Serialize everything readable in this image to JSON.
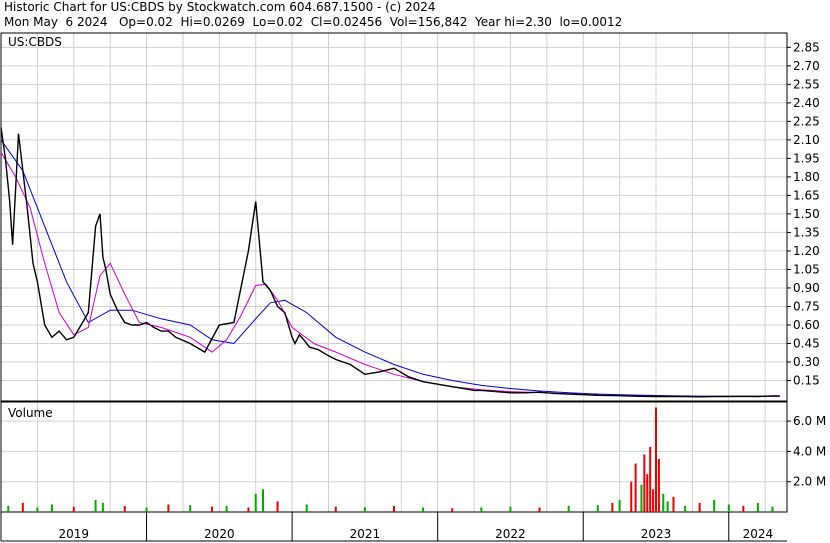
{
  "header": {
    "line1": "Historic Chart for US:CBDS by Stockwatch.com 604.687.1500 - (c) 2024",
    "line2": "Mon May  6 2024   Op=0.02  Hi=0.0269  Lo=0.02  Cl=0.02456  Vol=156,842  Year hi=2.30  lo=0.0012"
  },
  "chart_data": [
    {
      "type": "line",
      "title": "US:CBDS",
      "yticks": [
        "0.15",
        "0.30",
        "0.45",
        "0.60",
        "0.75",
        "0.90",
        "1.05",
        "1.20",
        "1.35",
        "1.50",
        "1.65",
        "1.80",
        "1.95",
        "2.10",
        "2.25",
        "2.40",
        "2.55",
        "2.70",
        "2.85"
      ],
      "ylim": [
        0,
        2.95
      ],
      "xlim": [
        2019.0,
        2024.4
      ],
      "grid": true,
      "colors": {
        "price": "#000000",
        "ma_short": "#cc00cc",
        "ma_long": "#0000cc"
      },
      "series": [
        {
          "id": "price",
          "x": [
            2019.0,
            2019.03,
            2019.06,
            2019.08,
            2019.1,
            2019.12,
            2019.16,
            2019.18,
            2019.22,
            2019.25,
            2019.3,
            2019.35,
            2019.4,
            2019.45,
            2019.5,
            2019.55,
            2019.6,
            2019.65,
            2019.68,
            2019.7,
            2019.72,
            2019.75,
            2019.8,
            2019.85,
            2019.9,
            2019.95,
            2020.0,
            2020.05,
            2020.1,
            2020.15,
            2020.2,
            2020.3,
            2020.4,
            2020.5,
            2020.6,
            2020.7,
            2020.75,
            2020.8,
            2020.85,
            2020.9,
            2020.95,
            2021.0,
            2021.02,
            2021.05,
            2021.08,
            2021.12,
            2021.18,
            2021.25,
            2021.3,
            2021.4,
            2021.5,
            2021.6,
            2021.7,
            2021.8,
            2021.9,
            2022.0,
            2022.1,
            2022.2,
            2022.25,
            2022.3,
            2022.4,
            2022.5,
            2022.6,
            2022.7,
            2022.8,
            2022.9,
            2023.0,
            2023.1,
            2023.2,
            2023.3,
            2023.4,
            2023.5,
            2023.6,
            2023.7,
            2023.8,
            2023.9,
            2024.0,
            2024.1,
            2024.2,
            2024.3,
            2024.35
          ],
          "y": [
            2.2,
            1.95,
            1.6,
            1.25,
            1.7,
            2.15,
            1.75,
            1.55,
            1.1,
            0.95,
            0.6,
            0.5,
            0.55,
            0.48,
            0.5,
            0.6,
            0.7,
            1.4,
            1.5,
            1.15,
            1.05,
            0.85,
            0.72,
            0.62,
            0.6,
            0.6,
            0.62,
            0.58,
            0.55,
            0.55,
            0.5,
            0.45,
            0.38,
            0.6,
            0.62,
            1.2,
            1.6,
            0.95,
            0.88,
            0.75,
            0.7,
            0.5,
            0.45,
            0.52,
            0.48,
            0.42,
            0.4,
            0.35,
            0.32,
            0.28,
            0.2,
            0.22,
            0.25,
            0.18,
            0.14,
            0.12,
            0.1,
            0.08,
            0.07,
            0.07,
            0.06,
            0.05,
            0.05,
            0.055,
            0.045,
            0.04,
            0.035,
            0.03,
            0.028,
            0.025,
            0.022,
            0.02,
            0.02,
            0.02,
            0.018,
            0.02,
            0.02,
            0.022,
            0.02,
            0.025,
            0.025
          ]
        },
        {
          "id": "ma_short",
          "x": [
            2019.0,
            2019.1,
            2019.2,
            2019.3,
            2019.4,
            2019.5,
            2019.6,
            2019.68,
            2019.75,
            2019.85,
            2019.95,
            2020.1,
            2020.3,
            2020.45,
            2020.55,
            2020.65,
            2020.75,
            2020.82,
            2020.9,
            2021.0,
            2021.15,
            2021.3,
            2021.5,
            2021.7,
            2021.9,
            2022.1,
            2022.3,
            2022.5,
            2022.7,
            2022.9,
            2023.1,
            2023.3,
            2023.5,
            2023.7,
            2023.9,
            2024.1,
            2024.35
          ],
          "y": [
            2.0,
            1.8,
            1.55,
            1.1,
            0.7,
            0.52,
            0.58,
            1.0,
            1.1,
            0.85,
            0.62,
            0.58,
            0.5,
            0.38,
            0.48,
            0.68,
            0.92,
            0.93,
            0.8,
            0.58,
            0.45,
            0.38,
            0.28,
            0.2,
            0.14,
            0.1,
            0.075,
            0.06,
            0.052,
            0.042,
            0.032,
            0.026,
            0.022,
            0.02,
            0.02,
            0.021,
            0.023
          ]
        },
        {
          "id": "ma_long",
          "x": [
            2019.0,
            2019.15,
            2019.3,
            2019.45,
            2019.6,
            2019.75,
            2019.9,
            2020.1,
            2020.3,
            2020.45,
            2020.6,
            2020.75,
            2020.85,
            2020.95,
            2021.1,
            2021.3,
            2021.5,
            2021.7,
            2021.9,
            2022.1,
            2022.3,
            2022.5,
            2022.7,
            2022.9,
            2023.1,
            2023.3,
            2023.5,
            2023.7,
            2023.9,
            2024.1,
            2024.35
          ],
          "y": [
            2.1,
            1.85,
            1.4,
            0.95,
            0.62,
            0.72,
            0.72,
            0.65,
            0.6,
            0.48,
            0.45,
            0.65,
            0.78,
            0.8,
            0.7,
            0.5,
            0.38,
            0.28,
            0.2,
            0.15,
            0.11,
            0.085,
            0.065,
            0.05,
            0.04,
            0.033,
            0.028,
            0.024,
            0.022,
            0.021,
            0.022
          ]
        }
      ]
    },
    {
      "type": "bar",
      "title": "Volume",
      "yticks": [
        "2.0 M",
        "4.0 M",
        "6.0 M"
      ],
      "ylim": [
        0,
        7000000
      ],
      "colors": {
        "up": "#00aa00",
        "down": "#ee0000"
      },
      "x": [
        2019.05,
        2019.15,
        2019.25,
        2019.35,
        2019.5,
        2019.65,
        2019.7,
        2019.85,
        2020.0,
        2020.15,
        2020.3,
        2020.45,
        2020.55,
        2020.7,
        2020.75,
        2020.8,
        2020.9,
        2021.1,
        2021.3,
        2021.5,
        2021.7,
        2021.9,
        2022.1,
        2022.3,
        2022.5,
        2022.7,
        2022.9,
        2023.1,
        2023.2,
        2023.25,
        2023.33,
        2023.36,
        2023.4,
        2023.42,
        2023.44,
        2023.46,
        2023.48,
        2023.5,
        2023.52,
        2023.55,
        2023.58,
        2023.62,
        2023.7,
        2023.8,
        2023.9,
        2024.0,
        2024.1,
        2024.2,
        2024.3
      ],
      "values": [
        400000,
        600000,
        300000,
        500000,
        350000,
        800000,
        600000,
        400000,
        300000,
        500000,
        450000,
        350000,
        400000,
        300000,
        1200000,
        1500000,
        700000,
        500000,
        350000,
        300000,
        400000,
        300000,
        250000,
        300000,
        350000,
        300000,
        400000,
        450000,
        600000,
        800000,
        2000000,
        3200000,
        1800000,
        3800000,
        2500000,
        4300000,
        1500000,
        6900000,
        3500000,
        1200000,
        700000,
        1000000,
        400000,
        600000,
        800000,
        500000,
        400000,
        600000,
        350000
      ],
      "up": [
        true,
        false,
        true,
        true,
        false,
        true,
        true,
        false,
        true,
        false,
        true,
        false,
        true,
        false,
        true,
        true,
        false,
        true,
        false,
        true,
        false,
        true,
        false,
        true,
        true,
        false,
        true,
        true,
        false,
        true,
        false,
        false,
        true,
        false,
        false,
        false,
        false,
        false,
        false,
        true,
        true,
        false,
        true,
        false,
        true,
        true,
        false,
        true,
        true
      ]
    }
  ],
  "xaxis": {
    "labels": [
      "2019",
      "2020",
      "2021",
      "2022",
      "2023",
      "2024"
    ],
    "positions": [
      2019.0,
      2020.0,
      2021.0,
      2022.0,
      2023.0,
      2024.0
    ]
  }
}
